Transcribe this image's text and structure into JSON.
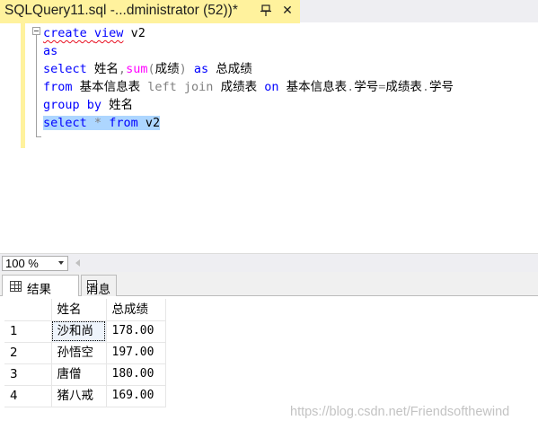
{
  "tab": {
    "title": "SQLQuery11.sql -...dministrator (52))*"
  },
  "editor": {
    "lines": {
      "l1": {
        "t1": "create",
        "t2": " ",
        "t3": "view",
        "t4": " v2"
      },
      "l2": {
        "t1": "as"
      },
      "l3": {
        "t1": "select",
        "t2": " 姓名",
        "t3": ",",
        "t4": "sum",
        "t5": "(",
        "t6": "成绩",
        "t7": ")",
        "t8": " ",
        "t9": "as",
        "t10": " 总成绩"
      },
      "l4": {
        "t1": "from",
        "t2": " 基本信息表 ",
        "t3": "left join",
        "t4": " 成绩表 ",
        "t5": "on",
        "t6": " 基本信息表",
        "t7": ".",
        "t8": "学号",
        "t9": "=",
        "t10": "成绩表",
        "t11": ".",
        "t12": "学号"
      },
      "l5": {
        "t1": "group by",
        "t2": " 姓名"
      },
      "l6": {
        "t1": "select",
        "t2": " ",
        "t3": "*",
        "t4": " ",
        "t5": "from",
        "t6": " v2"
      }
    }
  },
  "zoom": {
    "value": "100 %"
  },
  "results_tabs": {
    "results_label": "结果",
    "messages_label": "消息"
  },
  "results_grid": {
    "columns": [
      "姓名",
      "总成绩"
    ],
    "rows": [
      {
        "num": "1",
        "name": "沙和尚",
        "total": "178.00"
      },
      {
        "num": "2",
        "name": "孙悟空",
        "total": "197.00"
      },
      {
        "num": "3",
        "name": "唐僧",
        "total": "180.00"
      },
      {
        "num": "4",
        "name": "猪八戒",
        "total": "169.00"
      }
    ]
  },
  "watermark": "https://blog.csdn.net/Friendsofthewind",
  "colors": {
    "keyword": "#0000ff",
    "operator_gray": "#808080",
    "function": "#ff00ff",
    "tab_highlight": "#fff29d",
    "selection": "#add6ff"
  },
  "icons": [
    "pin-icon",
    "close-icon",
    "chevron-down-icon",
    "scroll-left-icon",
    "grid-icon",
    "message-icon"
  ]
}
